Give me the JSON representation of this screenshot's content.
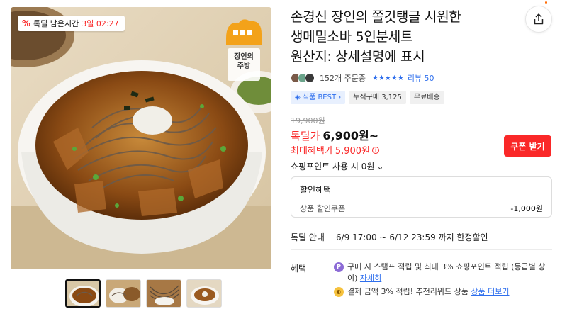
{
  "timer": {
    "badge_icon": "%",
    "label": "톡딜 남은시간",
    "remaining": "3일 02:27"
  },
  "brand_logo": {
    "text_line1": "장인의",
    "text_line2": "주방"
  },
  "thumbnails": [
    {
      "name": "thumb-1",
      "active": true
    },
    {
      "name": "thumb-2",
      "active": false
    },
    {
      "name": "thumb-3",
      "active": false
    },
    {
      "name": "thumb-4",
      "active": false
    }
  ],
  "title": "손경신 장인의 쫄깃탱글 시원한\n생메밀소바 5인분세트\n원산지: 상세설명에 표시",
  "rating": {
    "orders": "152개 주문중",
    "stars": "★★★★★",
    "review_link": "리뷰 50"
  },
  "tags": [
    {
      "label": "◈ 식품 BEST ›",
      "style": "blue"
    },
    {
      "label": "누적구매 3,125",
      "style": "gray"
    },
    {
      "label": "무료배송",
      "style": "gray"
    }
  ],
  "price": {
    "original": "19,900원",
    "deal_label": "톡딜가",
    "deal_price": "6,900원~",
    "max_benefit_label": "최대혜택가",
    "max_benefit_price": "5,900원",
    "info_icon": "i",
    "coupon_button": "쿠폰 받기",
    "points_text": "쇼핑포인트 사용 시 0원",
    "points_chevron": "⌄"
  },
  "discount": {
    "header": "할인혜택",
    "item_label": "상품 할인쿠폰",
    "item_amount": "-1,000원"
  },
  "event": {
    "label": "톡딜 안내",
    "text": "6/9 17:00 ~ 6/12 23:59 까지 한정할인"
  },
  "benefits": {
    "label": "혜택",
    "items": [
      {
        "icon": "P",
        "text": "구매 시 스탬프 적립 및 최대 3% 쇼핑포인트 적립 (등급별 상이) ",
        "link": "자세히"
      },
      {
        "icon": "◐",
        "text": "결제 금액 3% 적립! 추천리워드 상품 ",
        "link": "상품 더보기"
      }
    ]
  },
  "colors": {
    "accent_red": "#fa2828",
    "link_blue": "#2f6fed"
  }
}
